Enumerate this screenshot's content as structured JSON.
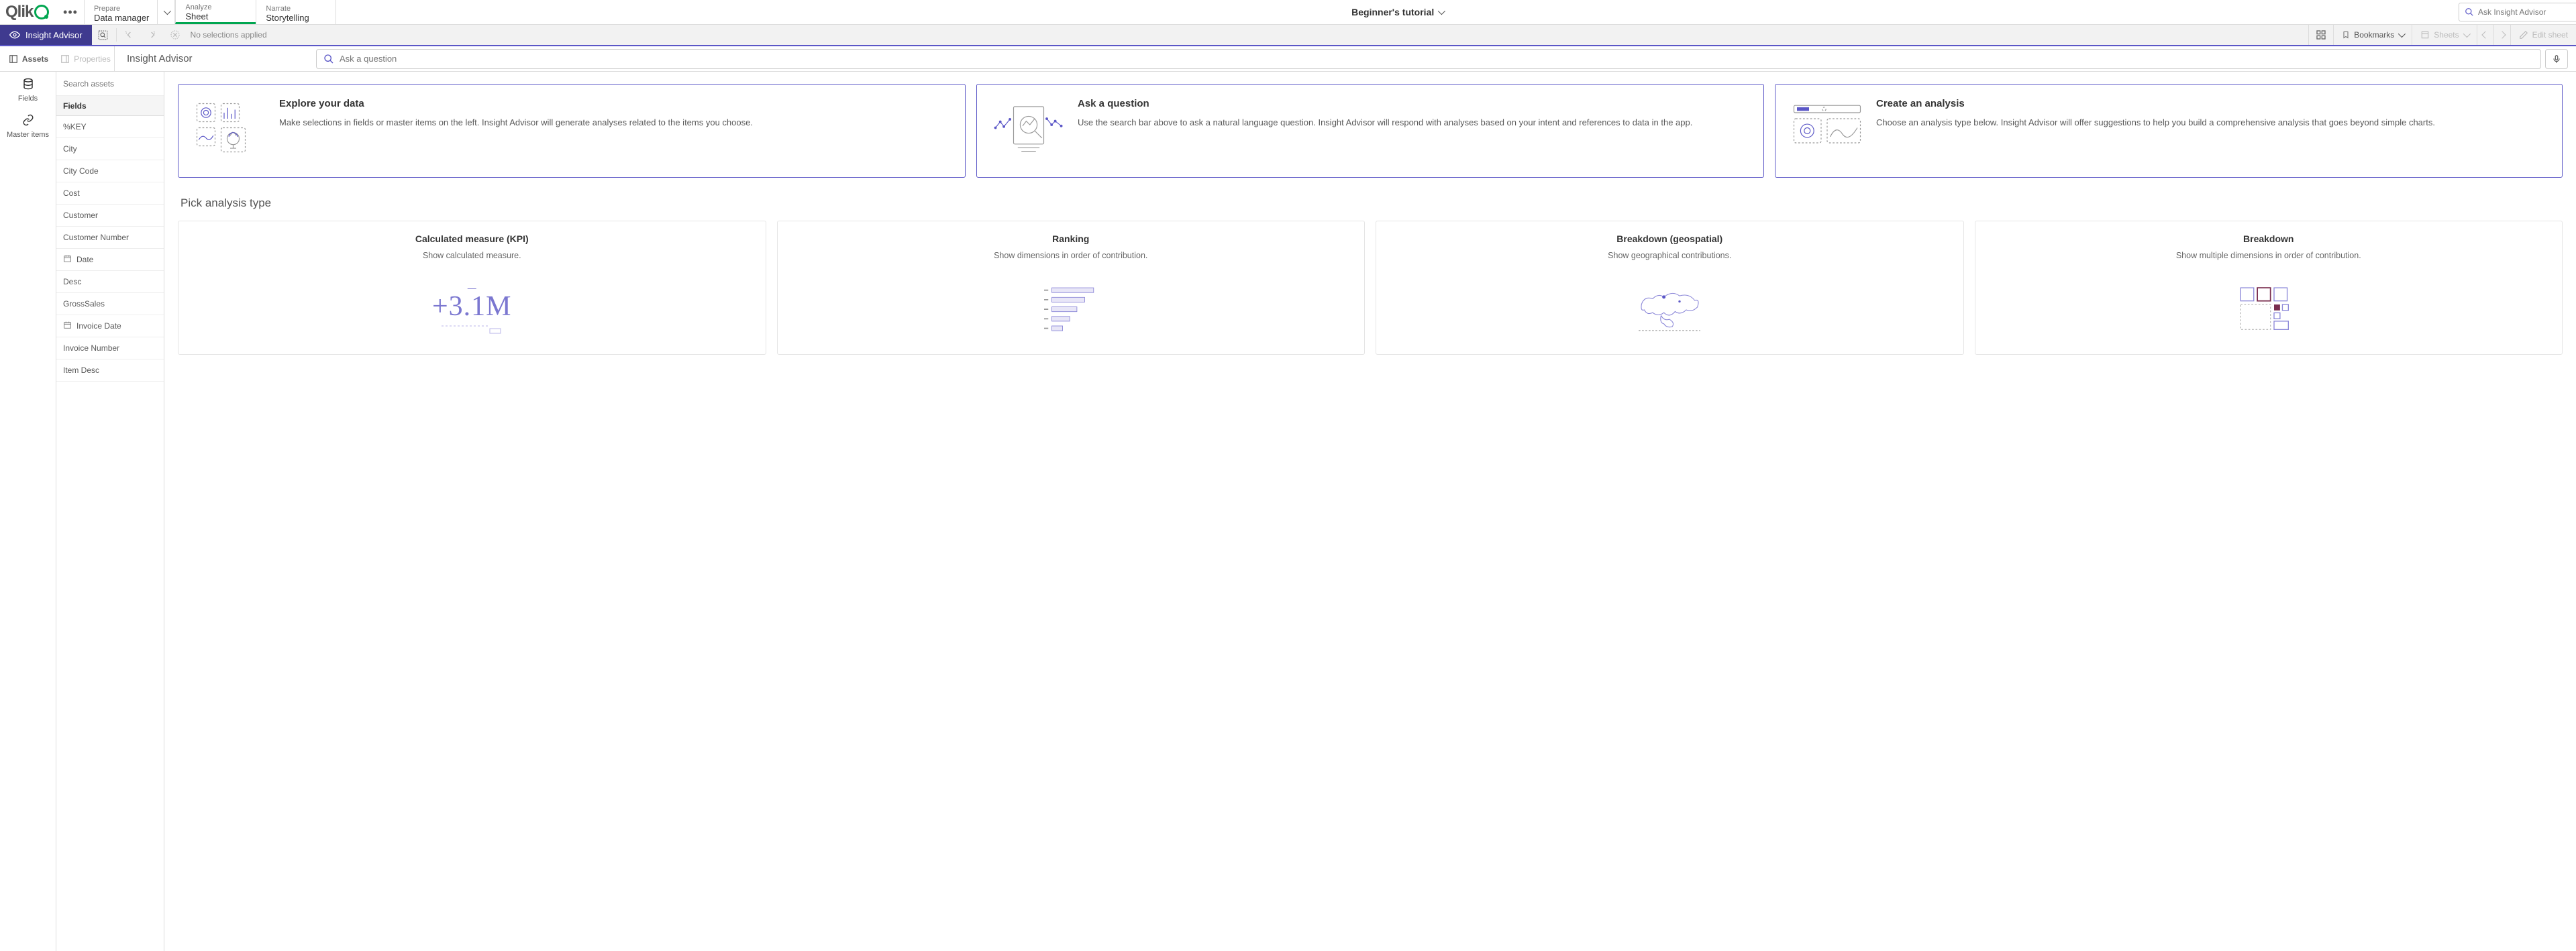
{
  "topnav": {
    "prepare": {
      "sup": "Prepare",
      "main": "Data manager"
    },
    "analyze": {
      "sup": "Analyze",
      "main": "Sheet"
    },
    "narrate": {
      "sup": "Narrate",
      "main": "Storytelling"
    }
  },
  "app_title": "Beginner's tutorial",
  "top_search_placeholder": "Ask Insight Advisor",
  "toolbar": {
    "insight_label": "Insight Advisor",
    "no_selections": "No selections applied",
    "bookmarks": "Bookmarks",
    "sheets": "Sheets",
    "edit": "Edit sheet"
  },
  "subtoolbar": {
    "assets": "Assets",
    "properties": "Properties",
    "title": "Insight Advisor",
    "search_placeholder": "Ask a question"
  },
  "rail": {
    "fields": "Fields",
    "master": "Master items"
  },
  "asset_panel": {
    "search_placeholder": "Search assets",
    "header": "Fields",
    "fields": [
      "%KEY",
      "City",
      "City Code",
      "Cost",
      "Customer",
      "Customer Number",
      "Date",
      "Desc",
      "GrossSales",
      "Invoice Date",
      "Invoice Number",
      "Item Desc"
    ]
  },
  "date_fields": [
    "Date",
    "Invoice Date"
  ],
  "intro_cards": [
    {
      "title": "Explore your data",
      "body": "Make selections in fields or master items on the left. Insight Advisor will generate analyses related to the items you choose."
    },
    {
      "title": "Ask a question",
      "body": "Use the search bar above to ask a natural language question. Insight Advisor will respond with analyses based on your intent and references to data in the app."
    },
    {
      "title": "Create an analysis",
      "body": "Choose an analysis type below. Insight Advisor will offer suggestions to help you build a comprehensive analysis that goes beyond simple charts."
    }
  ],
  "section_header": "Pick analysis type",
  "analysis_cards": [
    {
      "title": "Calculated measure (KPI)",
      "body": "Show calculated measure.",
      "kpi": "+3.1M"
    },
    {
      "title": "Ranking",
      "body": "Show dimensions in order of contribution."
    },
    {
      "title": "Breakdown (geospatial)",
      "body": "Show geographical contributions."
    },
    {
      "title": "Breakdown",
      "body": "Show multiple dimensions in order of contribution."
    }
  ]
}
